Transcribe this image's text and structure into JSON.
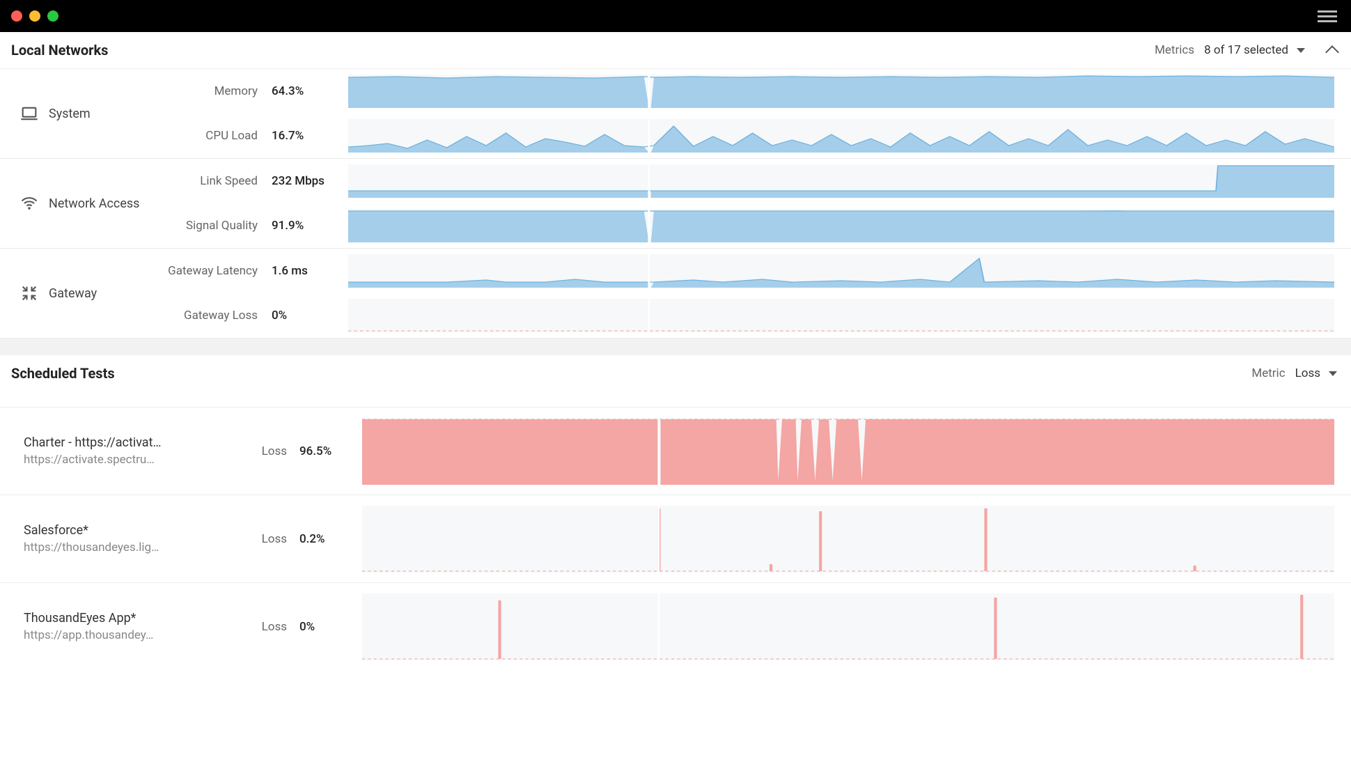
{
  "titlebar": {
    "has_hamburger": true
  },
  "local_networks": {
    "title": "Local Networks",
    "metrics_label": "Metrics",
    "metrics_selected": "8 of 17 selected",
    "groups": [
      {
        "id": "system",
        "icon": "laptop",
        "label": "System",
        "metrics": [
          {
            "name": "Memory",
            "value": "64.3%"
          },
          {
            "name": "CPU Load",
            "value": "16.7%"
          }
        ]
      },
      {
        "id": "network-access",
        "icon": "wifi",
        "label": "Network Access",
        "metrics": [
          {
            "name": "Link Speed",
            "value": "232 Mbps"
          },
          {
            "name": "Signal Quality",
            "value": "91.9%"
          }
        ]
      },
      {
        "id": "gateway",
        "icon": "collapse",
        "label": "Gateway",
        "metrics": [
          {
            "name": "Gateway Latency",
            "value": "1.6 ms"
          },
          {
            "name": "Gateway Loss",
            "value": "0%"
          }
        ]
      }
    ]
  },
  "scheduled_tests": {
    "title": "Scheduled Tests",
    "metric_label": "Metric",
    "metric_value": "Loss",
    "tests": [
      {
        "name": "Charter - https://activat…",
        "url": "https://activate.spectru…",
        "metric": "Loss",
        "value": "96.5%"
      },
      {
        "name": "Salesforce*",
        "url": "https://thousandeyes.lig…",
        "metric": "Loss",
        "value": "0.2%"
      },
      {
        "name": "ThousandEyes App*",
        "url": "https://app.thousandey…",
        "metric": "Loss",
        "value": "0%"
      }
    ]
  },
  "chart_data": [
    {
      "type": "area",
      "title": "Memory",
      "ylim": [
        0,
        100
      ],
      "values_pct": [
        64,
        64,
        65,
        64,
        63,
        64,
        65,
        64,
        64,
        65,
        66,
        64,
        64
      ],
      "note": "roughly flat ~64%"
    },
    {
      "type": "area",
      "title": "CPU Load",
      "ylim": [
        0,
        100
      ],
      "values_pct": [
        10,
        15,
        20,
        12,
        25,
        14,
        30,
        18,
        40,
        16,
        22,
        28,
        15,
        35,
        18,
        14,
        30,
        12,
        20,
        15,
        25,
        14,
        18,
        30,
        14,
        12,
        25,
        14
      ],
      "note": "spiky 10–40%"
    },
    {
      "type": "area",
      "title": "Link Speed",
      "ylim": [
        0,
        300
      ],
      "values_mbps": [
        120,
        120,
        120,
        120,
        120,
        120,
        120,
        120,
        120,
        120,
        120,
        120,
        120,
        120,
        120,
        120,
        120,
        120,
        120,
        120,
        120,
        232,
        232,
        232
      ],
      "note": "step up at right to 232"
    },
    {
      "type": "area",
      "title": "Signal Quality",
      "ylim": [
        0,
        100
      ],
      "values_pct": [
        92,
        92,
        92,
        91,
        92,
        92,
        92,
        91,
        92,
        92,
        92,
        92,
        92
      ],
      "note": "flat ~92%"
    },
    {
      "type": "line",
      "title": "Gateway Latency",
      "ylim": [
        0,
        20
      ],
      "values_ms": [
        1.5,
        1.6,
        1.7,
        1.5,
        2.2,
        1.6,
        2.8,
        1.7,
        1.5,
        2.5,
        1.6,
        1.5,
        2.0,
        1.6,
        1.5,
        2.2,
        1.6,
        1.5,
        3.0,
        1.6,
        1.5,
        10,
        1.6,
        1.5,
        2.3,
        1.6,
        1.5,
        2.0,
        1.6
      ],
      "note": "low baseline with one big spike ~75% along"
    },
    {
      "type": "line",
      "title": "Gateway Loss",
      "ylim": [
        0,
        100
      ],
      "values_pct": [
        0,
        0,
        0,
        0,
        0,
        0,
        0,
        0,
        0,
        0,
        0,
        0,
        0
      ]
    },
    {
      "type": "area",
      "title": "Charter Loss",
      "ylim": [
        0,
        100
      ],
      "values_pct": [
        100,
        100,
        100,
        100,
        100,
        100,
        100,
        100,
        100,
        100,
        100,
        100,
        100,
        100,
        100,
        5,
        100,
        8,
        100,
        6,
        100,
        100,
        100,
        100,
        100,
        100,
        100,
        100
      ],
      "note": "near-constant 100% with several brief dips mid-right"
    },
    {
      "type": "area",
      "title": "Salesforce Loss",
      "ylim": [
        0,
        100
      ],
      "values_pct": [
        0,
        0,
        0,
        0,
        0,
        0,
        0,
        0,
        0,
        0,
        0,
        0,
        0,
        80,
        0,
        0,
        0,
        0,
        60,
        0,
        0,
        0,
        0,
        90,
        0,
        0,
        0,
        0,
        0,
        0,
        10,
        0
      ],
      "note": "near-zero with ~4 narrow spikes"
    },
    {
      "type": "area",
      "title": "ThousandEyes App Loss",
      "ylim": [
        0,
        100
      ],
      "values_pct": [
        0,
        0,
        0,
        0,
        0,
        0,
        0,
        70,
        0,
        0,
        0,
        0,
        0,
        0,
        0,
        0,
        0,
        0,
        0,
        0,
        0,
        0,
        0,
        0,
        0,
        90,
        0,
        0,
        0,
        0,
        0,
        0,
        0,
        100
      ],
      "note": "near-zero with ~3 narrow spikes"
    }
  ]
}
